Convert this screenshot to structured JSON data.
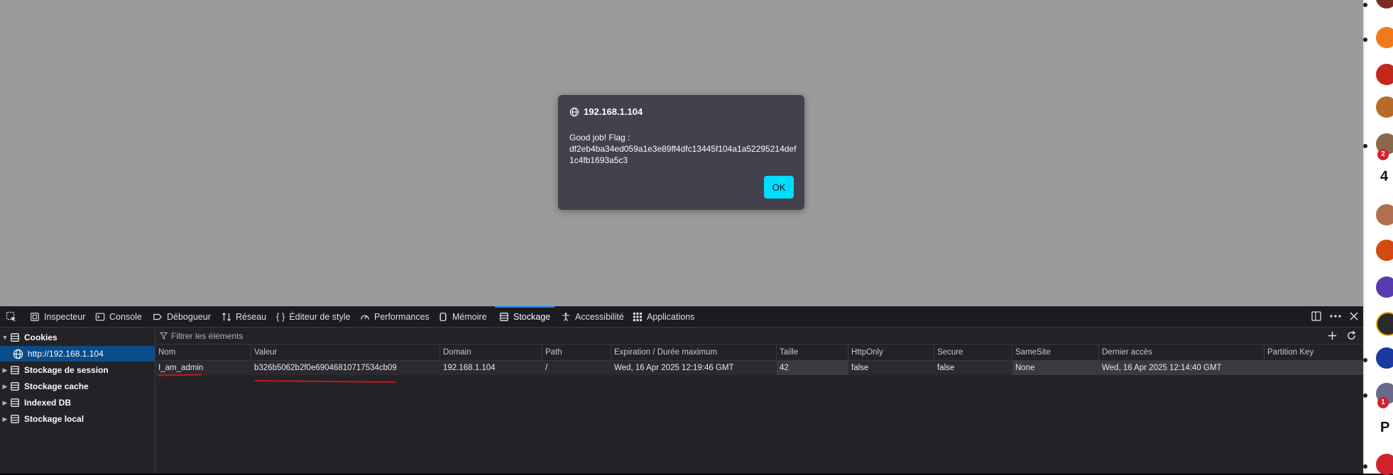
{
  "alert": {
    "origin": "192.168.1.104",
    "message": "Good job! Flag :\ndf2eb4ba34ed059a1e3e89ff4dfc13445f104a1a52295214def1c4fb1693a5c3",
    "ok_label": "OK"
  },
  "devtools": {
    "tabs": [
      {
        "label": "Inspecteur",
        "icon": "inspector-icon"
      },
      {
        "label": "Console",
        "icon": "console-icon"
      },
      {
        "label": "Débogueur",
        "icon": "debugger-icon"
      },
      {
        "label": "Réseau",
        "icon": "network-icon"
      },
      {
        "label": "Éditeur de style",
        "icon": "style-editor-icon"
      },
      {
        "label": "Performances",
        "icon": "performance-icon"
      },
      {
        "label": "Mémoire",
        "icon": "memory-icon"
      },
      {
        "label": "Stockage",
        "icon": "storage-icon",
        "active": true
      },
      {
        "label": "Accessibilité",
        "icon": "accessibility-icon"
      },
      {
        "label": "Applications",
        "icon": "applications-icon"
      }
    ],
    "sidebar": {
      "cookies": "Cookies",
      "cookie_host": "http://192.168.1.104",
      "session": "Stockage de session",
      "cache": "Stockage cache",
      "indexeddb": "Indexed DB",
      "local": "Stockage local"
    },
    "filter_placeholder": "Filtrer les éléments",
    "columns": [
      "Nom",
      "Valeur",
      "Domain",
      "Path",
      "Expiration / Durée maximum",
      "Taille",
      "HttpOnly",
      "Secure",
      "SameSite",
      "Dernier accès",
      "Partition Key"
    ],
    "rows": [
      {
        "name": "I_am_admin",
        "value": "b326b5062b2f0e69046810717534cb09",
        "domain": "192.168.1.104",
        "path": "/",
        "expires": "Wed, 16 Apr 2025 12:19:46 GMT",
        "size": "42",
        "httponly": "false",
        "secure": "false",
        "samesite": "None",
        "last_accessed": "Wed, 16 Apr 2025 12:14:40 GMT",
        "partition_key": ""
      }
    ]
  },
  "colors": {
    "accent": "#0a84ff",
    "ok_button": "#00ddff",
    "annotation": "#c0181d"
  }
}
